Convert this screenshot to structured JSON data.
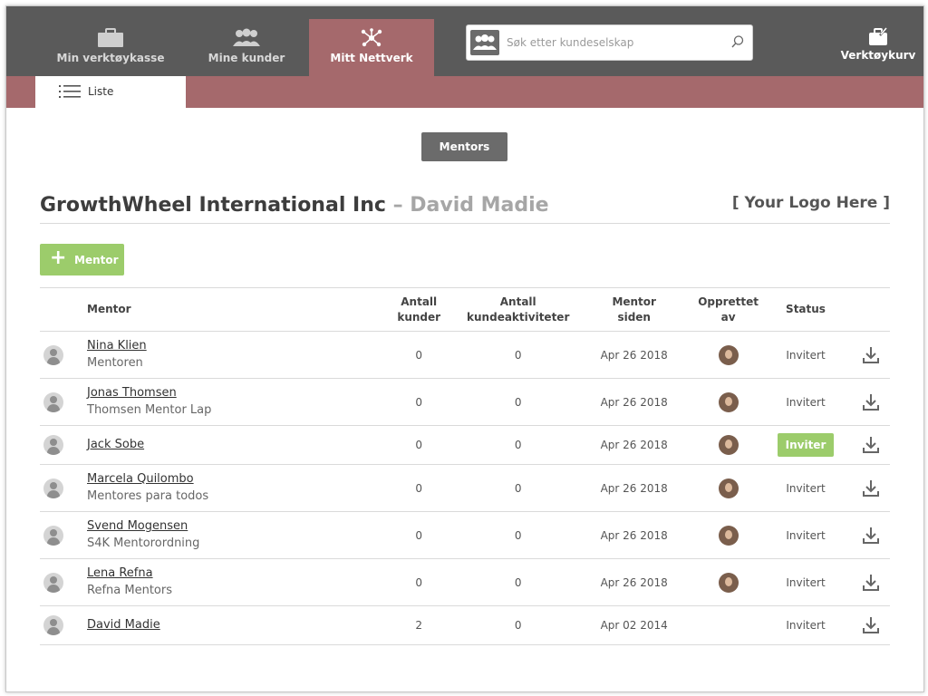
{
  "nav": {
    "items": [
      {
        "label": "Min verktøykasse",
        "icon": "toolbox-icon"
      },
      {
        "label": "Mine kunder",
        "icon": "people-icon"
      },
      {
        "label": "Mitt Nettverk",
        "icon": "network-icon",
        "active": true
      }
    ],
    "search_placeholder": "Søk etter kundeselskap",
    "cart_label": "Verktøykurv"
  },
  "subnav": {
    "tab_label": "Liste"
  },
  "filter": {
    "mentors_label": "Mentors"
  },
  "heading": {
    "company": "GrowthWheel International Inc",
    "separator": "–",
    "person": "David Madie"
  },
  "logo_text": "[ Your Logo Here ]",
  "add_button_label": "Mentor",
  "table": {
    "headers": {
      "mentor": "Mentor",
      "antall_kunder_1": "Antall",
      "antall_kunder_2": "kunder",
      "antall_akt_1": "Antall",
      "antall_akt_2": "kundeaktiviteter",
      "siden_1": "Mentor",
      "siden_2": "siden",
      "opprettet_1": "Opprettet",
      "opprettet_2": "av",
      "status": "Status"
    },
    "rows": [
      {
        "name": "Nina Klien",
        "org": "Mentoren",
        "kunder": "0",
        "aktiviteter": "0",
        "siden": "Apr 26 2018",
        "status": "Invitert"
      },
      {
        "name": "Jonas Thomsen",
        "org": "Thomsen Mentor Lap",
        "kunder": "0",
        "aktiviteter": "0",
        "siden": "Apr 26 2018",
        "status": "Invitert"
      },
      {
        "name": "Jack Sobe",
        "org": "",
        "kunder": "0",
        "aktiviteter": "0",
        "siden": "Apr 26 2018",
        "status": "Inviter"
      },
      {
        "name": "Marcela Quilombo",
        "org": "Mentores para todos",
        "kunder": "0",
        "aktiviteter": "0",
        "siden": "Apr 26 2018",
        "status": "Invitert"
      },
      {
        "name": "Svend Mogensen",
        "org": "S4K Mentorordning",
        "kunder": "0",
        "aktiviteter": "0",
        "siden": "Apr 26 2018",
        "status": "Invitert"
      },
      {
        "name": "Lena Refna",
        "org": "Refna Mentors",
        "kunder": "0",
        "aktiviteter": "0",
        "siden": "Apr 26 2018",
        "status": "Invitert"
      },
      {
        "name": "David Madie",
        "org": "",
        "kunder": "2",
        "aktiviteter": "0",
        "siden": "Apr 02 2014",
        "status": "Invitert"
      }
    ]
  },
  "colors": {
    "topbar": "#5a5a5a",
    "accent": "#a5696c",
    "green": "#9ccc6b"
  }
}
